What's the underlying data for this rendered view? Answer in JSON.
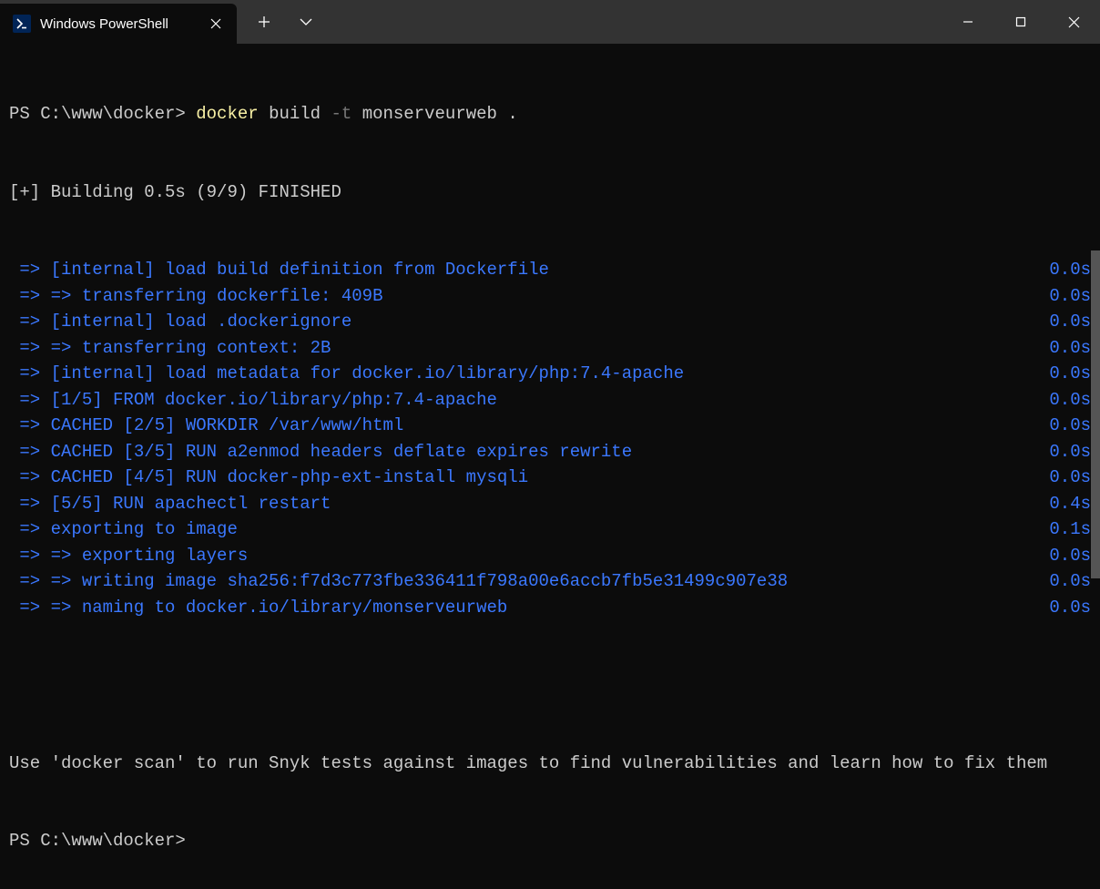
{
  "titlebar": {
    "tab_title": "Windows PowerShell"
  },
  "terminal": {
    "prompt1": "PS C:\\www\\docker> ",
    "cmd_docker": "docker ",
    "cmd_build": "build ",
    "cmd_flag": "-t ",
    "cmd_args": "monserveurweb .",
    "status": "[+] Building 0.5s (9/9) FINISHED",
    "lines": [
      {
        "text": " => [internal] load build definition from Dockerfile",
        "time": "0.0s"
      },
      {
        "text": " => => transferring dockerfile: 409B",
        "time": "0.0s"
      },
      {
        "text": " => [internal] load .dockerignore",
        "time": "0.0s"
      },
      {
        "text": " => => transferring context: 2B",
        "time": "0.0s"
      },
      {
        "text": " => [internal] load metadata for docker.io/library/php:7.4-apache",
        "time": "0.0s"
      },
      {
        "text": " => [1/5] FROM docker.io/library/php:7.4-apache",
        "time": "0.0s"
      },
      {
        "text": " => CACHED [2/5] WORKDIR /var/www/html",
        "time": "0.0s"
      },
      {
        "text": " => CACHED [3/5] RUN a2enmod headers deflate expires rewrite",
        "time": "0.0s"
      },
      {
        "text": " => CACHED [4/5] RUN docker-php-ext-install mysqli",
        "time": "0.0s"
      },
      {
        "text": " => [5/5] RUN apachectl restart",
        "time": "0.4s"
      },
      {
        "text": " => exporting to image",
        "time": "0.1s"
      },
      {
        "text": " => => exporting layers",
        "time": "0.0s"
      },
      {
        "text": " => => writing image sha256:f7d3c773fbe336411f798a00e6accb7fb5e31499c907e38",
        "time": "0.0s"
      },
      {
        "text": " => => naming to docker.io/library/monserveurweb",
        "time": "0.0s"
      }
    ],
    "footer": "Use 'docker scan' to run Snyk tests against images to find vulnerabilities and learn how to fix them",
    "prompt2": "PS C:\\www\\docker>"
  }
}
